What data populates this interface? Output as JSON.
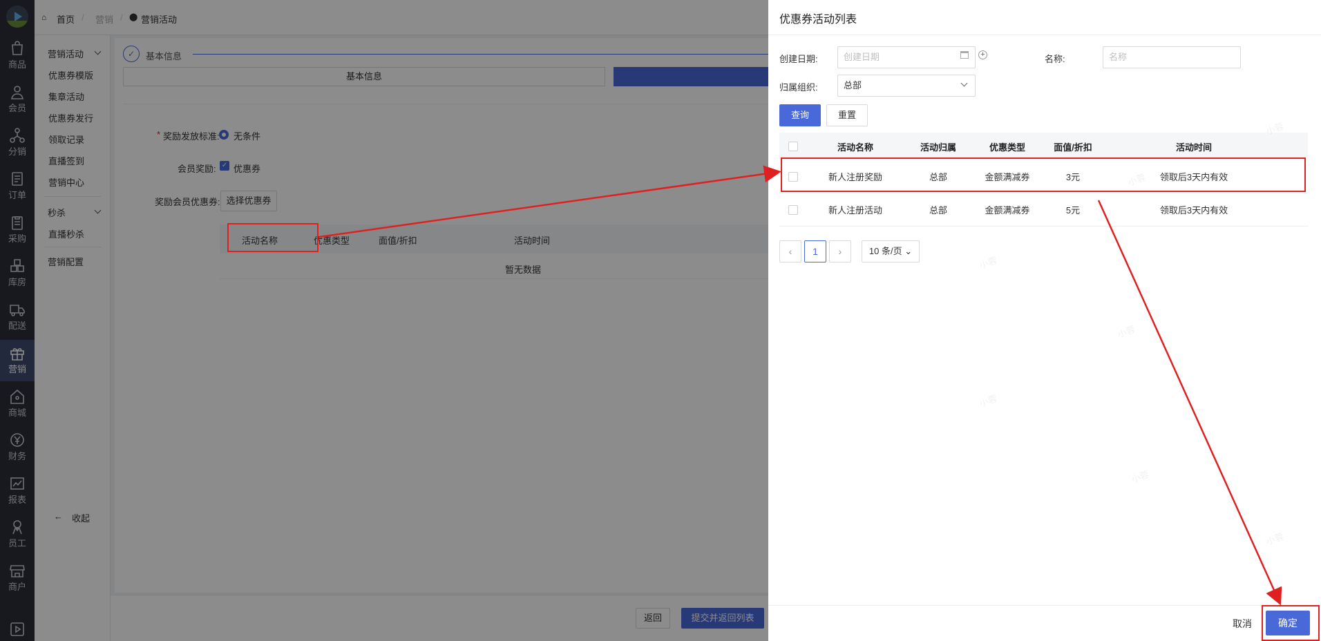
{
  "rail": {
    "items": [
      {
        "label": "商品",
        "icon": "bag-icon"
      },
      {
        "label": "会员",
        "icon": "person-icon"
      },
      {
        "label": "分销",
        "icon": "network-icon"
      },
      {
        "label": "订单",
        "icon": "document-icon"
      },
      {
        "label": "采购",
        "icon": "clipboard-icon"
      },
      {
        "label": "库房",
        "icon": "grid-icon"
      },
      {
        "label": "配送",
        "icon": "truck-icon"
      },
      {
        "label": "营销",
        "icon": "gift-icon"
      },
      {
        "label": "商城",
        "icon": "store-icon"
      },
      {
        "label": "财务",
        "icon": "yen-icon"
      },
      {
        "label": "报表",
        "icon": "chart-icon"
      },
      {
        "label": "员工",
        "icon": "staff-icon"
      },
      {
        "label": "商户",
        "icon": "shop-icon"
      }
    ],
    "active": "营销"
  },
  "breadcrumb": {
    "home": "首页",
    "level1": "营销",
    "level2": "营销活动"
  },
  "sidebar": {
    "group1": "营销活动",
    "items1": [
      "优惠券模版",
      "集章活动",
      "优惠券发行",
      "领取记录",
      "直播签到",
      "营销中心"
    ],
    "group2": "秒杀",
    "items2": [
      "直播秒杀"
    ],
    "config": "营销配置",
    "collapse": "收起"
  },
  "form": {
    "step_label": "基本信息",
    "tab_label": "基本信息",
    "reward_standard_label": "奖励发放标准:",
    "reward_standard_value": "无条件",
    "member_reward_label": "会员奖励:",
    "member_reward_value": "优惠券",
    "reward_coupon_label": "奖励会员优惠券:",
    "select_coupon_button": "选择优惠券",
    "table_headers": [
      "活动名称",
      "优惠类型",
      "面值/折扣",
      "活动时间"
    ],
    "empty_text": "暂无数据"
  },
  "footer": {
    "back": "返回",
    "submit": "提交并返回列表"
  },
  "drawer": {
    "title": "优惠券活动列表",
    "create_date_label": "创建日期:",
    "create_date_placeholder": "创建日期",
    "name_label": "名称:",
    "name_placeholder": "名称",
    "org_label": "归属组织:",
    "org_value": "总部",
    "query_button": "查询",
    "reset_button": "重置",
    "headers": [
      "活动名称",
      "活动归属",
      "优惠类型",
      "面值/折扣",
      "活动时间"
    ],
    "rows": [
      {
        "name": "新人注册奖励",
        "owner": "总部",
        "type": "金额满减券",
        "value": "3元",
        "time": "领取后3天内有效"
      },
      {
        "name": "新人注册活动",
        "owner": "总部",
        "type": "金额满减券",
        "value": "5元",
        "time": "领取后3天内有效"
      }
    ],
    "pager": {
      "current": "1",
      "page_size": "10 条/页"
    },
    "cancel_button": "取消",
    "confirm_button": "确定",
    "watermark": "小蓉"
  },
  "colors": {
    "primary": "#4a69d9",
    "highlight": "#e02020",
    "rail_bg": "#2b2f3a"
  }
}
